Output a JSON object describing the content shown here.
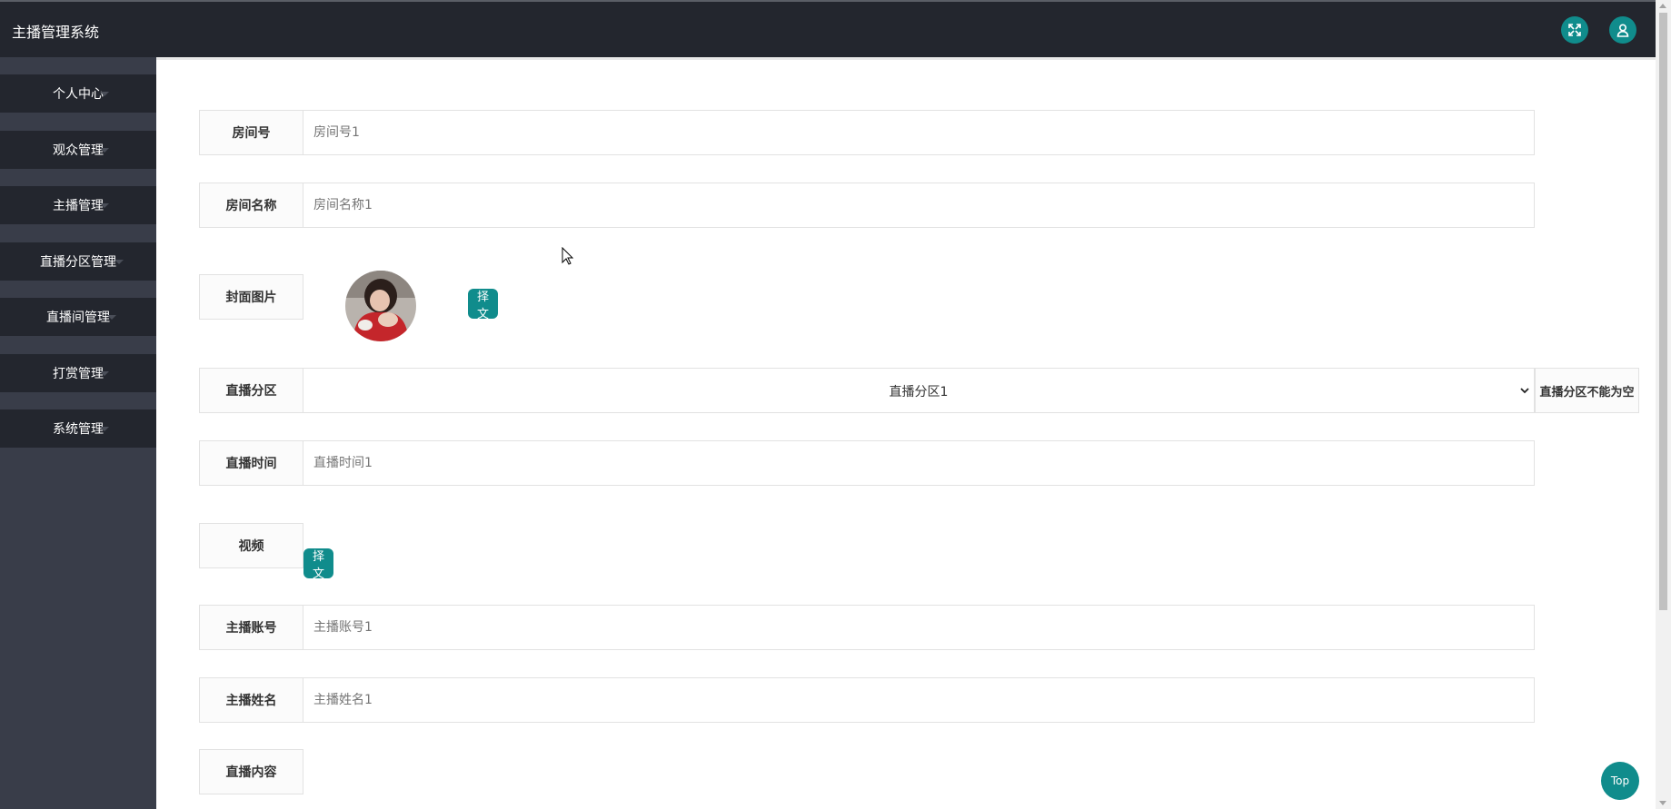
{
  "app": {
    "title": "主播管理系统"
  },
  "header": {
    "fullscreen_icon": "fullscreen-icon",
    "user_icon": "user-icon"
  },
  "sidebar": {
    "items": [
      {
        "label": "个人中心"
      },
      {
        "label": "观众管理"
      },
      {
        "label": "主播管理"
      },
      {
        "label": "直播分区管理"
      },
      {
        "label": "直播间管理"
      },
      {
        "label": "打赏管理"
      },
      {
        "label": "系统管理"
      }
    ]
  },
  "form": {
    "room_no": {
      "label": "房间号",
      "placeholder": "房间号1"
    },
    "room_name": {
      "label": "房间名称",
      "placeholder": "房间名称1"
    },
    "cover": {
      "label": "封面图片",
      "button": "选择文件"
    },
    "category": {
      "label": "直播分区",
      "value": "直播分区1",
      "hint": "直播分区不能为空"
    },
    "live_time": {
      "label": "直播时间",
      "placeholder": "直播时间1"
    },
    "video": {
      "label": "视频",
      "button": "选择文件"
    },
    "anchor_account": {
      "label": "主播账号",
      "placeholder": "主播账号1"
    },
    "anchor_name": {
      "label": "主播姓名",
      "placeholder": "主播姓名1"
    },
    "live_content": {
      "label": "直播内容"
    }
  },
  "float": {
    "top_label": "Top"
  },
  "colors": {
    "accent": "#108c8c",
    "header_bg": "#23262e",
    "sidebar_bg": "#393d49"
  }
}
